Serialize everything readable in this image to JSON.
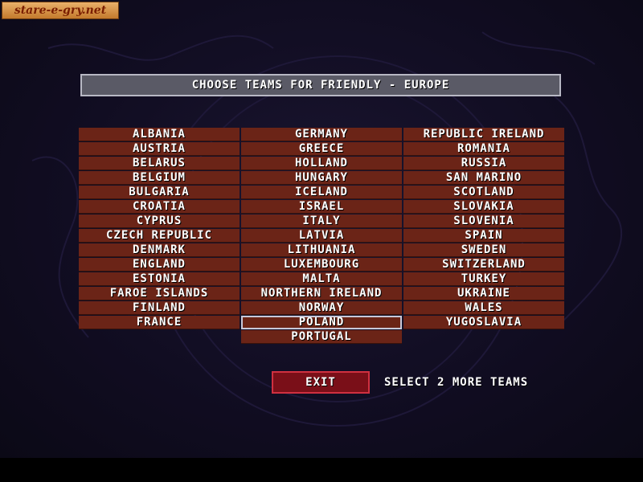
{
  "watermark": "stare-e-gry.net",
  "title": "CHOOSE TEAMS FOR FRIENDLY - EUROPE",
  "columns": [
    [
      "ALBANIA",
      "AUSTRIA",
      "BELARUS",
      "BELGIUM",
      "BULGARIA",
      "CROATIA",
      "CYPRUS",
      "CZECH REPUBLIC",
      "DENMARK",
      "ENGLAND",
      "ESTONIA",
      "FAROE ISLANDS",
      "FINLAND",
      "FRANCE"
    ],
    [
      "GERMANY",
      "GREECE",
      "HOLLAND",
      "HUNGARY",
      "ICELAND",
      "ISRAEL",
      "ITALY",
      "LATVIA",
      "LITHUANIA",
      "LUXEMBOURG",
      "MALTA",
      "NORTHERN IRELAND",
      "NORWAY",
      "POLAND",
      "PORTUGAL"
    ],
    [
      "REPUBLIC IRELAND",
      "ROMANIA",
      "RUSSIA",
      "SAN MARINO",
      "SCOTLAND",
      "SLOVAKIA",
      "SLOVENIA",
      "SPAIN",
      "SWEDEN",
      "SWITZERLAND",
      "TURKEY",
      "UKRAINE",
      "WALES",
      "YUGOSLAVIA"
    ]
  ],
  "selected_team": "POLAND",
  "exit_label": "EXIT",
  "status": "SELECT 2 MORE TEAMS",
  "colors": {
    "team_bg": "#6b2417",
    "title_bg": "#5a5a66",
    "exit_bg": "#7a0f18",
    "background": "#110d22"
  }
}
